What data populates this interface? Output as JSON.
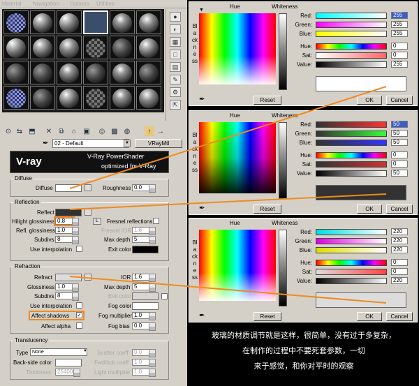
{
  "menu": [
    "Material",
    "Navigation",
    "Options",
    "Utilities"
  ],
  "material_name": "02 - Default",
  "material_type": "VRayMtl",
  "banner": {
    "logo": "V-ray",
    "line1": "V-Ray PowerShader",
    "line2": "optimized for V-Ray"
  },
  "diffuse": {
    "title": "Diffuse",
    "diffuse_label": "Diffuse",
    "roughness_label": "Roughness",
    "roughness": "0.0"
  },
  "reflection": {
    "title": "Reflection",
    "reflect": "Reflect",
    "hilight_label": "Hilight glossiness",
    "hilight": "0.8",
    "l_btn": "L",
    "fresnel": "Fresnel reflections",
    "refl_gloss_label": "Refl. glossiness",
    "refl_gloss": "1.0",
    "fresnel_ior_label": "Fresnel IOR",
    "fresnel_ior": "1.6",
    "subdivs_label": "Subdivs",
    "subdivs": "8",
    "max_depth_label": "Max depth",
    "max_depth": "5",
    "interp": "Use interpolation",
    "exit_color": "Exit color"
  },
  "refraction": {
    "title": "Refraction",
    "refract": "Refract",
    "ior_label": "IOR",
    "ior": "1.6",
    "gloss_label": "Glossiness",
    "gloss": "1.0",
    "max_depth_label": "Max depth",
    "max_depth": "5",
    "subdivs_label": "Subdivs",
    "subdivs": "8",
    "exit_color": "Exit color",
    "interp": "Use interpolation",
    "fog_color": "Fog color",
    "affect_shadows": "Affect shadows",
    "fog_mult_label": "Fog multiplier",
    "fog_mult": "1.0",
    "affect_alpha": "Affect alpha",
    "fog_bias_label": "Fog bias",
    "fog_bias": "0.0"
  },
  "translucency": {
    "title": "Translucency",
    "type_label": "Type",
    "type": "None",
    "scatter_label": "Scatter coeff",
    "scatter": "0.0",
    "back_label": "Back-side color",
    "fwd_label": "Fwd/bck coeff",
    "fwd": "1.0",
    "thickness_label": "Thickness",
    "thickness": "25400",
    "light_mult_label": "Light multiplier",
    "light_mult": "1.0"
  },
  "dialog_labels": {
    "hue": "Hue",
    "whiteness": "Whiteness",
    "blackness": "Blackness",
    "red": "Red:",
    "green": "Green:",
    "blue": "Blue:",
    "hue2": "Hue:",
    "sat": "Sat:",
    "value": "Value:",
    "reset": "Reset",
    "ok": "OK",
    "cancel": "Cancel"
  },
  "dialogs": [
    {
      "red": "255",
      "green": "255",
      "blue": "255",
      "hue": "0",
      "sat": "0",
      "value": "255",
      "preview": "#ffffff"
    },
    {
      "red": "50",
      "green": "50",
      "blue": "50",
      "hue": "0",
      "sat": "0",
      "value": "50",
      "preview": "#323232"
    },
    {
      "red": "220",
      "green": "220",
      "blue": "220",
      "hue": "0",
      "sat": "0",
      "value": "220",
      "preview": "#dcdcdc"
    }
  ],
  "colors": {
    "accent": "#f08a1e",
    "dialog_bg": "#d4d0c8"
  },
  "caption": [
    "玻璃的材质调节就是这样，很简单，没有过于多复杂，",
    "在制作的过程中不要死套参数，一切",
    "来于感觉，和你对平时的观察"
  ]
}
